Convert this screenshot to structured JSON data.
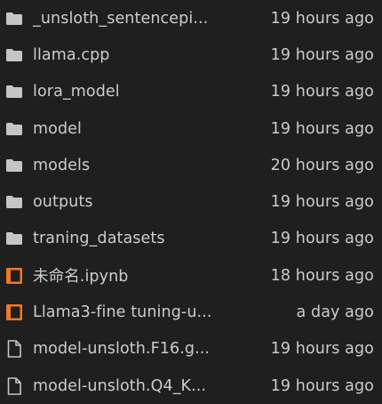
{
  "files": [
    {
      "name": "_unsloth_sentencepi...",
      "modified": "19 hours ago",
      "icon": "folder-icon"
    },
    {
      "name": "llama.cpp",
      "modified": "19 hours ago",
      "icon": "folder-icon"
    },
    {
      "name": "lora_model",
      "modified": "19 hours ago",
      "icon": "folder-icon"
    },
    {
      "name": "model",
      "modified": "19 hours ago",
      "icon": "folder-icon"
    },
    {
      "name": "models",
      "modified": "20 hours ago",
      "icon": "folder-icon"
    },
    {
      "name": "outputs",
      "modified": "19 hours ago",
      "icon": "folder-icon"
    },
    {
      "name": "traning_datasets",
      "modified": "19 hours ago",
      "icon": "folder-icon"
    },
    {
      "name": "未命名.ipynb",
      "modified": "18 hours ago",
      "icon": "notebook-icon"
    },
    {
      "name": "Llama3-fine tuning-u...",
      "modified": "a day ago",
      "icon": "notebook-icon"
    },
    {
      "name": "model-unsloth.F16.g...",
      "modified": "19 hours ago",
      "icon": "file-icon"
    },
    {
      "name": "model-unsloth.Q4_K...",
      "modified": "19 hours ago",
      "icon": "file-icon"
    }
  ],
  "colors": {
    "background": "#1f1f1f",
    "text": "#cccccc",
    "folder": "#c5c5c5",
    "notebook": "#f37726"
  }
}
